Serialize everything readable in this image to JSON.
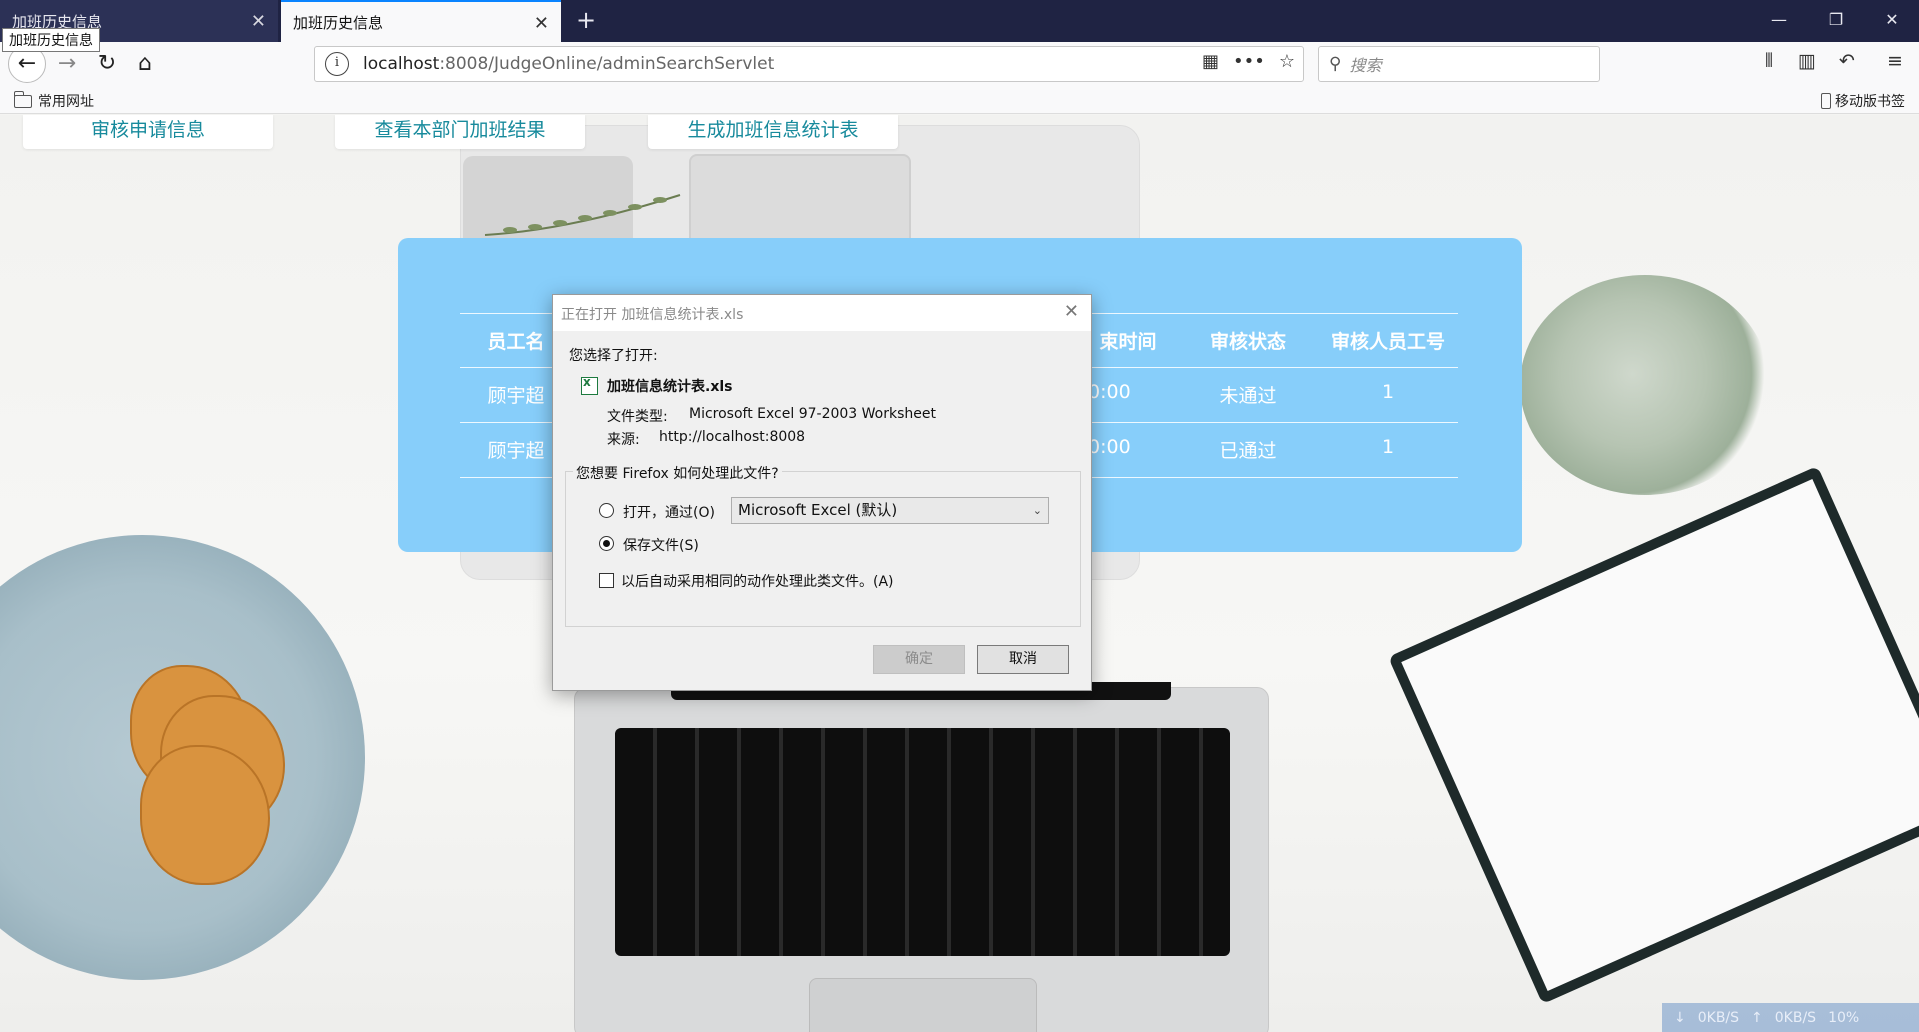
{
  "browser": {
    "tabs": [
      {
        "label": "加班历史信息",
        "active": false
      },
      {
        "label": "加班历史信息",
        "active": true
      }
    ],
    "tooltip": "加班历史信息",
    "url_host": "localhost",
    "url_rest": ":8008/JudgeOnline/adminSearchServlet",
    "search_placeholder": "搜索",
    "bookmarks_left": "常用网址",
    "bookmarks_right": "移动版书签",
    "window_controls": {
      "minimize": "—",
      "restore": "❐",
      "close": "✕"
    }
  },
  "topnav": {
    "items": [
      {
        "label": "审核申请信息"
      },
      {
        "label": "查看本部门加班结果"
      },
      {
        "label": "生成加班信息统计表"
      }
    ]
  },
  "table": {
    "visible_headers": {
      "col_name": "员工名",
      "col_end": "束时间",
      "col_status": "审核状态",
      "col_reviewer": "审核人员工号"
    },
    "rows": [
      {
        "name": "顾宇超",
        "end_time": "0:00",
        "status": "未通过",
        "reviewer": "1"
      },
      {
        "name": "顾宇超",
        "end_time": "0:00",
        "status": "已通过",
        "reviewer": "1"
      }
    ]
  },
  "dialog": {
    "title": "正在打开 加班信息统计表.xls",
    "intro": "您选择了打开:",
    "file_name": "加班信息统计表.xls",
    "file_type_label": "文件类型:",
    "file_type_value": "Microsoft Excel 97-2003 Worksheet",
    "source_label": "来源:",
    "source_value": "http://localhost:8008",
    "question": "您想要 Firefox 如何处理此文件?",
    "open_with_label": "打开，通过(O)",
    "open_with_app": "Microsoft Excel (默认)",
    "save_file_label": "保存文件(S)",
    "auto_label": "以后自动采用相同的动作处理此类文件。(A)",
    "ok_label": "确定",
    "cancel_label": "取消",
    "selected_option": "save"
  },
  "netmon": {
    "down": "0KB/S",
    "up": "0KB/S",
    "percent": "10%"
  },
  "colors": {
    "panel_blue": "#87cefa",
    "nav_text": "#178a9c",
    "tabbar": "#1f2343",
    "accent": "#0a84ff"
  }
}
